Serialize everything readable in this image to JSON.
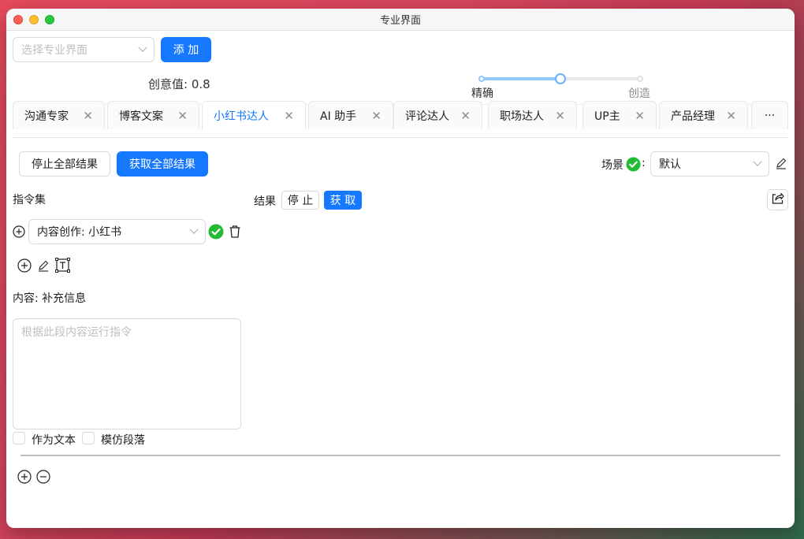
{
  "window": {
    "title": "专业界面"
  },
  "top": {
    "select_placeholder": "选择专业界面",
    "add_label": "添 加",
    "creativity_label": "创意值: 0.8",
    "creativity_value": 0.5,
    "slider_left_label": "精确",
    "slider_right_label": "创造"
  },
  "tabs": [
    {
      "label": "沟通专家"
    },
    {
      "label": "博客文案"
    },
    {
      "label": "小红书达人"
    },
    {
      "label": "AI 助手"
    },
    {
      "label": "评论达人"
    },
    {
      "label": "职场达人"
    },
    {
      "label": "UP主"
    },
    {
      "label": "产品经理"
    }
  ],
  "tabs_more": "···",
  "toolbar": {
    "stop_all": "停止全部结果",
    "fetch_all": "获取全部结果",
    "scene_label": "场景",
    "scene_colon": ":",
    "scene_value": "默认"
  },
  "left": {
    "instructions_title": "指令集",
    "instruction_select": "内容创作: 小红书",
    "content_label": "内容: 补充信息",
    "textarea_placeholder": "根据此段内容运行指令",
    "as_text": "作为文本",
    "imitate": "模仿段落"
  },
  "result": {
    "label": "结果",
    "stop": "停 止",
    "fetch": "获 取"
  },
  "colors": {
    "primary": "#1677ff",
    "success": "#22bb33"
  }
}
